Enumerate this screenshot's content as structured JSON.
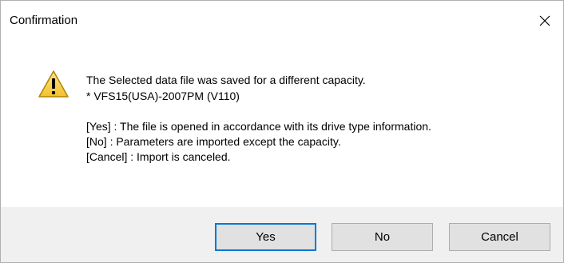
{
  "window": {
    "title": "Confirmation",
    "close_icon": "close-icon"
  },
  "message": {
    "icon": "warning-icon",
    "line1": "The Selected data file was saved for a different capacity.",
    "line2": "* VFS15(USA)-2007PM (V110)",
    "line3": "[Yes] : The file is opened in accordance with its drive type information.",
    "line4": "[No] : Parameters are imported except the capacity.",
    "line5": "[Cancel] : Import is canceled."
  },
  "buttons": {
    "yes": "Yes",
    "no": "No",
    "cancel": "Cancel"
  },
  "colors": {
    "footer_bg": "#f0f0f0",
    "button_bg": "#e1e1e1",
    "default_button_border": "#0078d7",
    "warning_fill": "#f7d046",
    "warning_stroke": "#b08500"
  }
}
